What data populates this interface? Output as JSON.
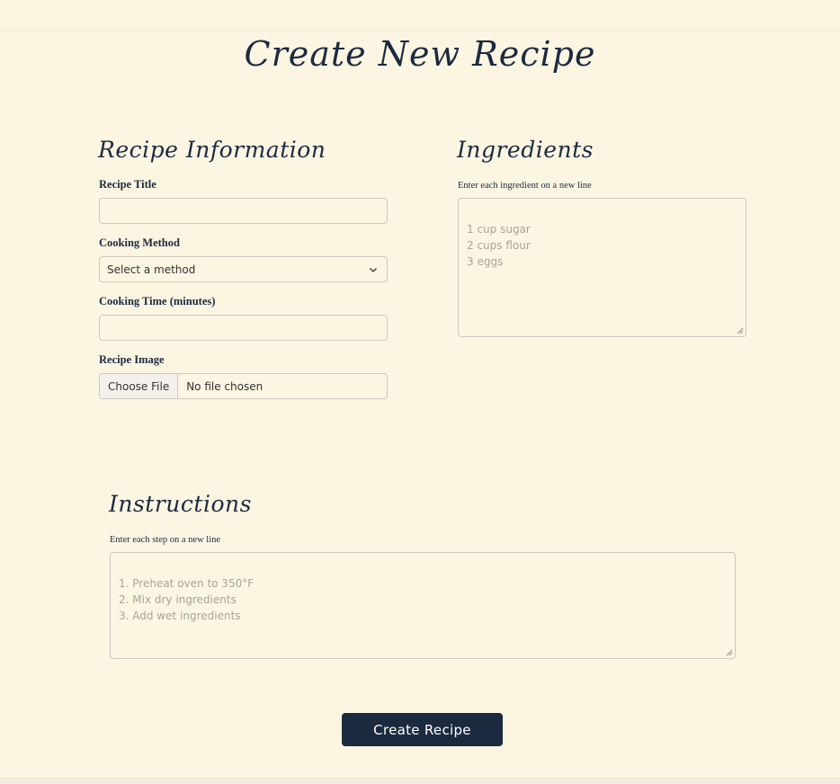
{
  "page_title": "Create New Recipe",
  "info_section": {
    "title": "Recipe Information",
    "recipe_title_label": "Recipe Title",
    "recipe_title_value": "",
    "cooking_method_label": "Cooking Method",
    "cooking_method_value": "Select a method",
    "cooking_time_label": "Cooking Time (minutes)",
    "cooking_time_value": "",
    "image_label": "Recipe Image",
    "file_button": "Choose File",
    "file_status": "No file chosen"
  },
  "ingredients_section": {
    "title": "Ingredients",
    "hint": "Enter each ingredient on a new line",
    "placeholder": "1 cup sugar\n2 cups flour\n3 eggs"
  },
  "instructions_section": {
    "title": "Instructions",
    "hint": "Enter each step on a new line",
    "placeholder": "1. Preheat oven to 350°F\n2. Mix dry ingredients\n3. Add wet ingredients"
  },
  "submit_label": "Create Recipe",
  "colors": {
    "background": "#fcf5e2",
    "primary": "#1c2a40",
    "border": "#ccc8bd",
    "placeholder": "#a8a49c"
  },
  "icons": {
    "select_arrow": "chevron-down-icon",
    "resize": "resize-grip-icon"
  }
}
